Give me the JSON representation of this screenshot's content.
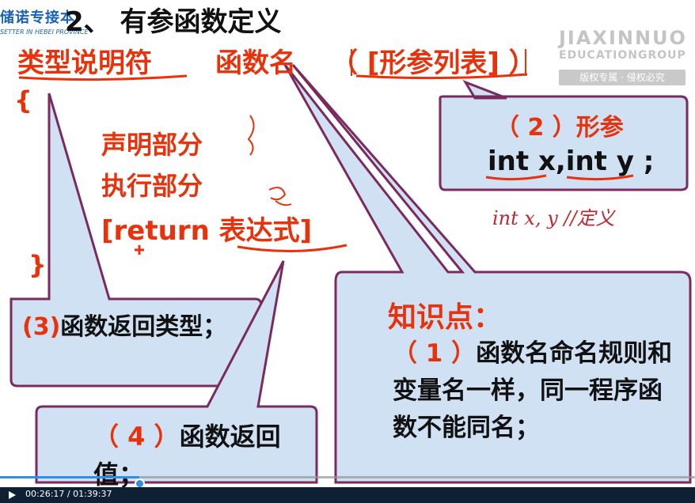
{
  "header": {
    "logo_cn": "储诺专接本",
    "logo_en": "SETTER IN HEBEI PROVINCE",
    "title": "2、 有参函数定义",
    "watermark_line1": "JIAXINNUO",
    "watermark_line2": "EDUCATIONGROUP",
    "watermark_line3": "版权专属 · 侵权必究"
  },
  "syntax": {
    "type_specifier": "类型说明符",
    "function_name": "函数名",
    "params": "（ [形参列表] ）",
    "brace_open": "{",
    "decl": "声明部分",
    "exec": "执行部分",
    "ret": "[return 表达式]",
    "brace_close": "}"
  },
  "callouts": {
    "c2_label": "（ 2 ）形参",
    "c2_code": "int x,int y ;",
    "c3_num": "(3)",
    "c3_text": "函数返回类型；",
    "c4_num": "（ 4 ）",
    "c4_text": "函数返回值；",
    "knowledge_title": "知识点：",
    "knowledge_num": "（ 1 ）",
    "knowledge_body": "函数名命名规则和变量名一样，同一程序函数不能同名；"
  },
  "handwriting": "int x, y //定义",
  "player": {
    "time": "00:26:17 / 01:39:37",
    "progress_fraction": 0.2
  },
  "colors": {
    "accent_red": "#e8320c",
    "callout_fill": "#cfe1f3",
    "callout_border": "#7b2a5e",
    "progress_blue": "#2d8fe8"
  }
}
